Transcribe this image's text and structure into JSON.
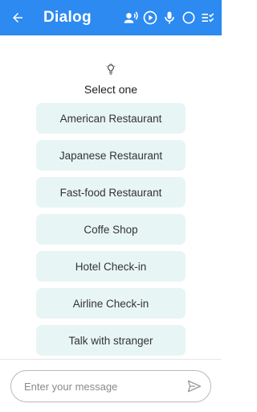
{
  "appbar": {
    "title": "Dialog",
    "back_icon": "arrow-left-icon",
    "actions": [
      "voice-speaker-icon",
      "play-circle-icon",
      "microphone-icon",
      "circle-icon",
      "checklist-icon"
    ],
    "background": "#2d8af0"
  },
  "prompt": {
    "icon": "lightbulb-icon",
    "label": "Select one"
  },
  "options": [
    {
      "label": "American Restaurant"
    },
    {
      "label": "Japanese Restaurant"
    },
    {
      "label": "Fast-food Restaurant"
    },
    {
      "label": "Coffe Shop"
    },
    {
      "label": "Hotel Check-in"
    },
    {
      "label": "Airline Check-in"
    },
    {
      "label": "Talk with stranger"
    }
  ],
  "composer": {
    "placeholder": "Enter your message",
    "value": "",
    "send_icon": "send-icon"
  }
}
